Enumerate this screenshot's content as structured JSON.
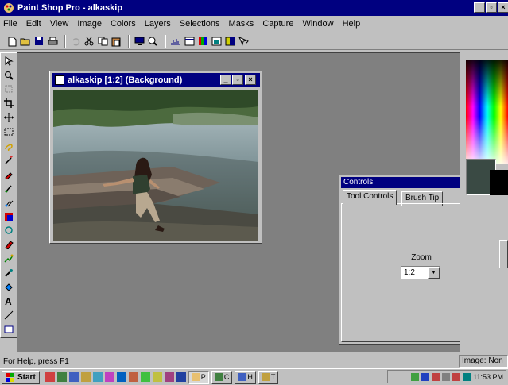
{
  "app": {
    "title": "Paint Shop Pro - alkaskip"
  },
  "menu": [
    "File",
    "Edit",
    "View",
    "Image",
    "Colors",
    "Layers",
    "Selections",
    "Masks",
    "Capture",
    "Window",
    "Help"
  ],
  "image_window": {
    "title": "alkaskip [1:2] (Background)"
  },
  "controls": {
    "title": "Controls",
    "tabs": [
      "Tool Controls",
      "Brush Tip"
    ],
    "zoom_label": "Zoom",
    "zoom_value": "1:2"
  },
  "status": {
    "help": "For Help, press F1",
    "image_info": "Image: Non"
  },
  "taskbar": {
    "start_label": "Start",
    "tasks": [
      "P",
      "C",
      "H",
      "T"
    ],
    "clock": "11:53 PM"
  },
  "colors": {
    "titlebar": "#000080",
    "face": "#c0c0c0",
    "workspace": "#808080",
    "foreground_swatch": "#3a4a44",
    "background_swatch": "#000000"
  }
}
